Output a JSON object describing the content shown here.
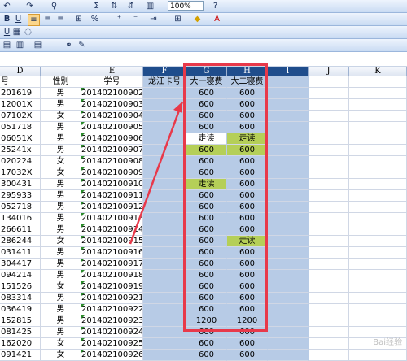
{
  "toolbar": {
    "row1": {
      "zoom": "100%"
    },
    "row2": {
      "bold": "B",
      "underline": "U"
    },
    "row3": {
      "underline": "U"
    }
  },
  "columns": [
    "D",
    "E",
    "F",
    "G",
    "H",
    "I",
    "J",
    "K"
  ],
  "header": [
    "号",
    "性别",
    "学号",
    "龙江卡号",
    "大一寝费",
    "大二寝费",
    "",
    ""
  ],
  "rows": [
    [
      "201619",
      "男",
      "201402100902",
      "",
      "600",
      "600"
    ],
    [
      "12001X",
      "男",
      "201402100903",
      "",
      "600",
      "600"
    ],
    [
      "07102X",
      "女",
      "201402100904",
      "",
      "600",
      "600"
    ],
    [
      "051718",
      "男",
      "201402100905",
      "",
      "600",
      "600"
    ],
    [
      "06051X",
      "男",
      "201402100906",
      "",
      "走读",
      "走读"
    ],
    [
      "25241x",
      "男",
      "201402100907",
      "",
      "600",
      "600"
    ],
    [
      "020224",
      "女",
      "201402100908",
      "",
      "600",
      "600"
    ],
    [
      "17032X",
      "女",
      "201402100909",
      "",
      "600",
      "600"
    ],
    [
      "300431",
      "男",
      "201402100910",
      "",
      "走读",
      "600"
    ],
    [
      "295933",
      "男",
      "201402100911",
      "",
      "600",
      "600"
    ],
    [
      "052718",
      "男",
      "201402100912",
      "",
      "600",
      "600"
    ],
    [
      "134016",
      "男",
      "201402100913",
      "",
      "600",
      "600"
    ],
    [
      "266611",
      "男",
      "201402100914",
      "",
      "600",
      "600"
    ],
    [
      "286244",
      "女",
      "201402100915",
      "",
      "600",
      "走读"
    ],
    [
      "031411",
      "男",
      "201402100916",
      "",
      "600",
      "600"
    ],
    [
      "304417",
      "男",
      "201402100917",
      "",
      "600",
      "600"
    ],
    [
      "094214",
      "男",
      "201402100918",
      "",
      "600",
      "600"
    ],
    [
      "151526",
      "女",
      "201402100919",
      "",
      "600",
      "600"
    ],
    [
      "083314",
      "男",
      "201402100921",
      "",
      "600",
      "600"
    ],
    [
      "036419",
      "男",
      "201402100922",
      "",
      "600",
      "600"
    ],
    [
      "152815",
      "男",
      "201402100923",
      "",
      "1200",
      "1200"
    ],
    [
      "081425",
      "男",
      "201402100924",
      "",
      "600",
      "600"
    ],
    [
      "162020",
      "女",
      "201402100925",
      "",
      "600",
      "600"
    ],
    [
      "091421",
      "女",
      "201402100926",
      "",
      "600",
      "600"
    ]
  ],
  "highlight_color": "#b5cf58",
  "annotation_color": "#e8394a"
}
